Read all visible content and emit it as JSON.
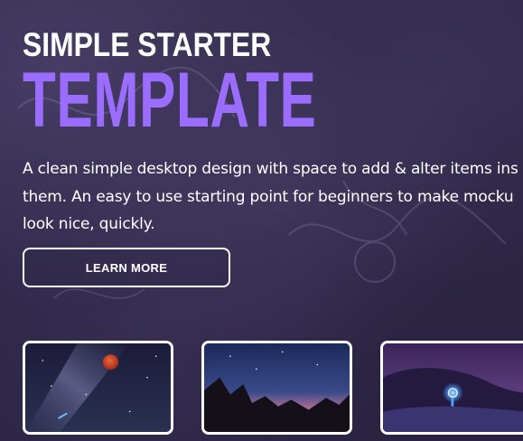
{
  "hero": {
    "title_line1": "SIMPLE STARTER",
    "title_line2": "TEMPLATE",
    "description_lines": [
      "A clean simple desktop design with space to add & alter items ins",
      "them. An easy to use starting point for beginners to make mocku",
      "look nice, quickly."
    ],
    "button_label": "LEARN MORE"
  },
  "colors": {
    "background": "#2b2440",
    "accent": "#9b6dff",
    "text": "#ffffff"
  },
  "cards": [
    {
      "subject": "night-sky-red-moon-image"
    },
    {
      "subject": "galaxy-over-rocks-image"
    },
    {
      "subject": "light-painting-snow-image"
    }
  ]
}
